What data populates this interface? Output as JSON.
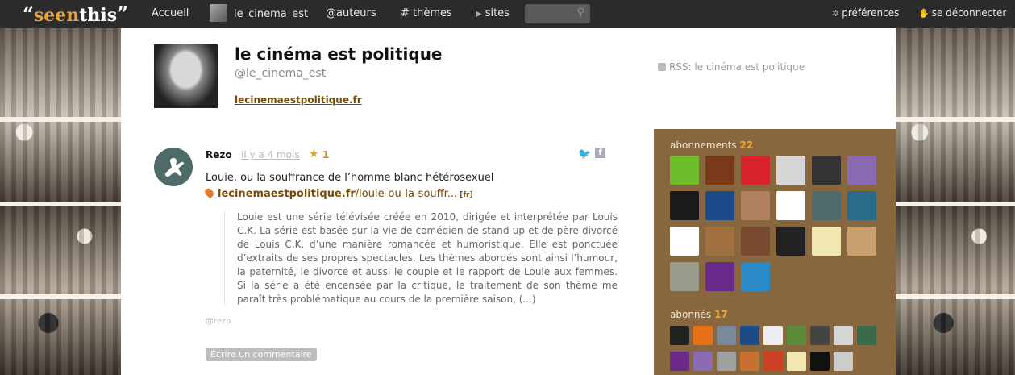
{
  "logo": {
    "quote_open": "“",
    "seen": "seen",
    "this": "this",
    "quote_close": "”"
  },
  "nav": {
    "home": "Accueil",
    "user": "le_cinema_est",
    "authors": "@auteurs",
    "themes": "# thèmes",
    "sites": "sites",
    "search_placeholder": "",
    "preferences": "préférences",
    "logout": "se déconnecter"
  },
  "profile": {
    "name": "le cinéma est politique",
    "handle": "@le_cinema_est",
    "website": "lecinemaestpolitique.fr",
    "rss": "RSS: le cinéma est politique"
  },
  "post": {
    "author": "Rezo",
    "date": "il y a 4 mois",
    "star_count": "1",
    "title": "Louie, ou la souffrance de l’homme blanc hétérosexuel",
    "link_domain": "lecinemaestpolitique.fr",
    "link_path": "/louie-ou-la-souffr...",
    "link_lang": "[fr]",
    "quote": "Louie est une série télévisée créée en 2010, dirigée et interprétée par Louis C.K. La série est basée sur la vie de comédien de stand-up et de père divorcé de Louis C.K, d’une manière romancée et humoristique. Elle est ponctuée d’ex­traits de ses propres spectacles. Les thèmes abordés sont ainsi l’humour, la paternité, le divorce et aussi le couple et le rapport de Louie aux femmes. Si la série a été encensée par la critique, le traitement de son thème me paraît très problématique au cours de la première saison, (...)",
    "footer_tag": "@rezo",
    "comment_button": "Écrire un commentaire"
  },
  "panel": {
    "subscriptions_label": "abonnements",
    "subscriptions_count": "22",
    "subscribers_label": "abonnés",
    "subscribers_count": "17",
    "subscription_avatars": [
      {
        "name": "avatar-green-quote",
        "color": "#6cbf2a"
      },
      {
        "name": "avatar-fire-logo",
        "color": "#7a3a1a"
      },
      {
        "name": "avatar-red-quote",
        "color": "#d8232a"
      },
      {
        "name": "avatar-default",
        "color": "#d6d6d6"
      },
      {
        "name": "avatar-checker",
        "color": "#333333"
      },
      {
        "name": "avatar-cartoon-face",
        "color": "#8a6ab0"
      },
      {
        "name": "avatar-robot",
        "color": "#1a1a1a"
      },
      {
        "name": "avatar-knot",
        "color": "#1c4a8a"
      },
      {
        "name": "avatar-person-1",
        "color": "#b08060"
      },
      {
        "name": "avatar-orange-t",
        "color": "#ffffff"
      },
      {
        "name": "avatar-teal-bird",
        "color": "#4e6b6a"
      },
      {
        "name": "avatar-person-2",
        "color": "#2a6a8a"
      },
      {
        "name": "avatar-invader",
        "color": "#ffffff"
      },
      {
        "name": "avatar-person-3",
        "color": "#a07040"
      },
      {
        "name": "avatar-person-4",
        "color": "#7a4a30"
      },
      {
        "name": "avatar-gm",
        "color": "#222222"
      },
      {
        "name": "avatar-sketch",
        "color": "#f0e8b0"
      },
      {
        "name": "avatar-glasses",
        "color": "#c8a070"
      },
      {
        "name": "avatar-photo",
        "color": "#9a9a8a"
      },
      {
        "name": "avatar-purple",
        "color": "#6a2a8a"
      },
      {
        "name": "avatar-eye-me",
        "color": "#2a8ac8"
      }
    ],
    "subscriber_avatars": [
      {
        "name": "sub-avatar-1",
        "color": "#222222"
      },
      {
        "name": "sub-avatar-2",
        "color": "#e8701a"
      },
      {
        "name": "sub-avatar-3",
        "color": "#7a8a9a"
      },
      {
        "name": "sub-avatar-4",
        "color": "#1c4a8a"
      },
      {
        "name": "sub-avatar-5",
        "color": "#eeeeee"
      },
      {
        "name": "sub-avatar-6",
        "color": "#5a8a3a"
      },
      {
        "name": "sub-avatar-7",
        "color": "#444444"
      },
      {
        "name": "sub-avatar-8",
        "color": "#d6d6d6"
      },
      {
        "name": "sub-avatar-9",
        "color": "#3a6a4a"
      },
      {
        "name": "sub-avatar-10",
        "color": "#6a2a8a"
      },
      {
        "name": "sub-avatar-11",
        "color": "#8a6ab0"
      },
      {
        "name": "sub-avatar-12",
        "color": "#a0a0a0"
      },
      {
        "name": "sub-avatar-13",
        "color": "#c87030"
      },
      {
        "name": "sub-avatar-14",
        "color": "#d04020"
      },
      {
        "name": "sub-avatar-15",
        "color": "#f0e8b0"
      },
      {
        "name": "sub-avatar-16",
        "color": "#111111"
      },
      {
        "name": "sub-avatar-17",
        "color": "#cccccc"
      }
    ]
  }
}
